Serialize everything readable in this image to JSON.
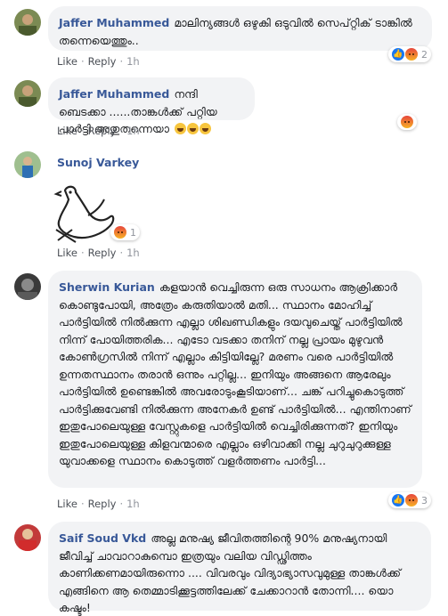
{
  "colors": {
    "name": "#385898",
    "bubble": "#f2f3f5",
    "action": "#90949c",
    "like": "#1877f2"
  },
  "actions": {
    "like": "Like",
    "reply": "Reply",
    "dot": "·"
  },
  "comments": [
    {
      "author": "Jaffer Muhammed",
      "text": "മാലിന്യങ്ങൾ ഒഴുകി ഒടുവിൽ സെപ്റ്റിക് ടാങ്കിൽ തന്നെയെത്തും..",
      "time": "1h",
      "reactions": [
        "like",
        "angry"
      ],
      "reaction_count": "2"
    },
    {
      "author": "Jaffer Muhammed",
      "text": "നന്ദി ബെടക്കാ ......താങ്കൾക്ക് പറ്റിയ പാർട്ടി അതുതന്നെയാ",
      "time": "1h",
      "reactions": [
        "angry"
      ],
      "reaction_count": ""
    },
    {
      "author": "Sunoj Varkey",
      "text": "",
      "sticker": "bird-sticker",
      "time": "1h",
      "reactions": [
        "angry"
      ],
      "reaction_count": "1"
    },
    {
      "author": "Sherwin Kurian",
      "text": "കളയാൻ വെച്ചിരുന്ന ഒരു സാധനം ആക്രിക്കാർ കൊണ്ടുപോയി, അത്രേം കരുതിയാൽ മതി... സ്ഥാനം മോഹിച്ച് പാർട്ടിയിൽ നിൽക്കുന്ന എല്ലാ ശിഖണ്ഡികളും ദയവുചെയ്ത് പാർട്ടിയിൽ നിന്ന് പോയിത്തരിക... എടോ വടക്കാ തനിന് നല്ല പ്രായം മുഴുവൻ കോൺഗ്രസിൽ നിന്ന് എല്ലാം കിട്ടിയില്ലേ? മരണം വരെ പാർട്ടിയിൽ ഉന്നതസ്ഥാനം തരാൻ ഒന്നും പറ്റില്ല... ഇനിയും അങ്ങനെ ആരേലും പാർട്ടിയിൽ ഉണ്ടെങ്കിൽ അവരോടുംകൂടിയാണ്... ചങ്ക് പറിച്ചുകൊടുത്ത് പാർട്ടിക്കുവേണ്ടി നിൽക്കുന്ന അനേകർ ഉണ്ട് പാർട്ടിയിൽ... എന്തിനാണ് ഇതുപോലെയുള്ള വേസ്റ്റുകളെ പാർട്ടിയിൽ വെച്ചിരിക്കുന്നത്? ഇനിയും ഇതുപോലെയുള്ള കിളവന്മാരെ എല്ലാം ഒഴിവാക്കി നല്ല ചുറുചുറുക്കുള്ള യുവാക്കളെ സ്ഥാനം കൊടുത്ത് വളർത്തണം പാർട്ടി...",
      "time": "1h",
      "reactions": [
        "like",
        "angry"
      ],
      "reaction_count": "3"
    },
    {
      "author": "Saif Soud Vkd",
      "text": "അല്ല മനുഷ്യ ജീവിതത്തിന്റെ 90% മനുഷ്യനായി ജീവിച്ച് ചാവാറാകുമ്പൊ ഇത്രയും വലിയ വിഡ്ഢിത്തം കാണിക്കണമായിരുന്നൊ .... വിവരവും വിദ്യാഭ്യാസവുമുള്ള താങ്കൾക്ക് എങ്ങിനെ ആ തെമ്മാടിക്കൂട്ടത്തിലേക്ക് ചേക്കാറാൻ തോന്നി.... യൊ കഷ്ടം!",
      "time": "",
      "reactions": [],
      "reaction_count": ""
    }
  ]
}
